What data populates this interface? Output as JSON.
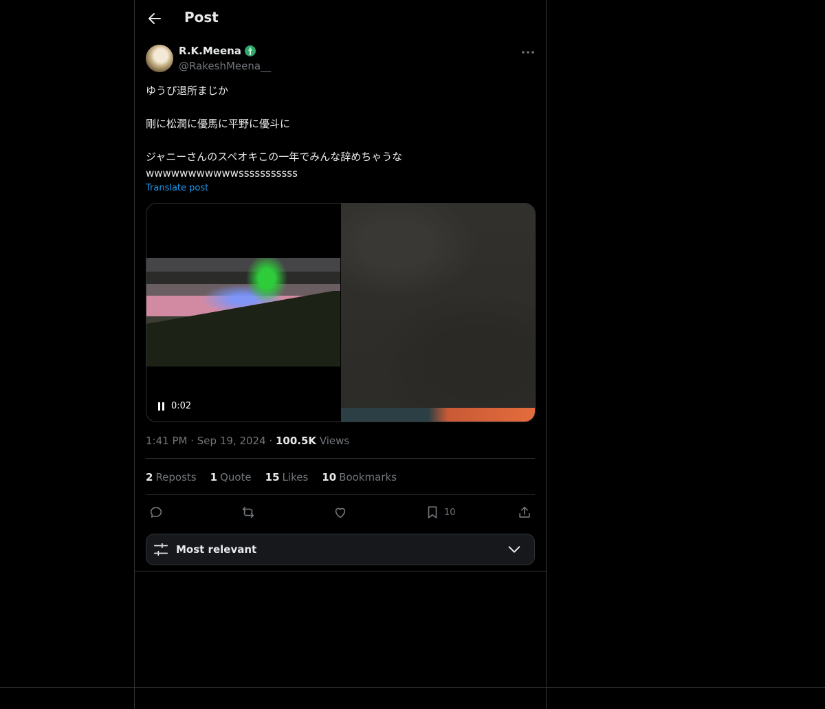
{
  "header": {
    "title": "Post"
  },
  "post": {
    "author_name": "R.K.Meena",
    "author_handle": "@RakeshMeena__",
    "text_lines": [
      "ゆうぴ退所まじか",
      "剛に松潤に優馬に平野に優斗に",
      "ジャニーさんのスペオキこの一年でみんな辞めちゃうな",
      "wwwwwwwwwwwsssssssssss"
    ],
    "translate_label": "Translate post",
    "video_time": "0:02",
    "time": "1:41 PM",
    "date": "Sep 19, 2024",
    "views_count": "100.5K",
    "views_label": "Views"
  },
  "stats": {
    "reposts_count": "2",
    "reposts_label": "Reposts",
    "quotes_count": "1",
    "quotes_label": "Quote",
    "likes_count": "15",
    "likes_label": "Likes",
    "bookmarks_count": "10",
    "bookmarks_label": "Bookmarks"
  },
  "actions": {
    "bookmark_count": "10"
  },
  "sort": {
    "label": "Most relevant"
  },
  "icons": {
    "back": "arrow-left-icon",
    "more": "more-horizontal-icon",
    "reply": "reply-icon",
    "repost": "repost-icon",
    "like": "heart-icon",
    "bookmark": "bookmark-icon",
    "share": "share-icon",
    "sort": "sliders-icon",
    "chevron": "chevron-down-icon"
  },
  "colors": {
    "accent": "#1d9bf0",
    "muted": "#71767b",
    "border": "#2f3336"
  }
}
